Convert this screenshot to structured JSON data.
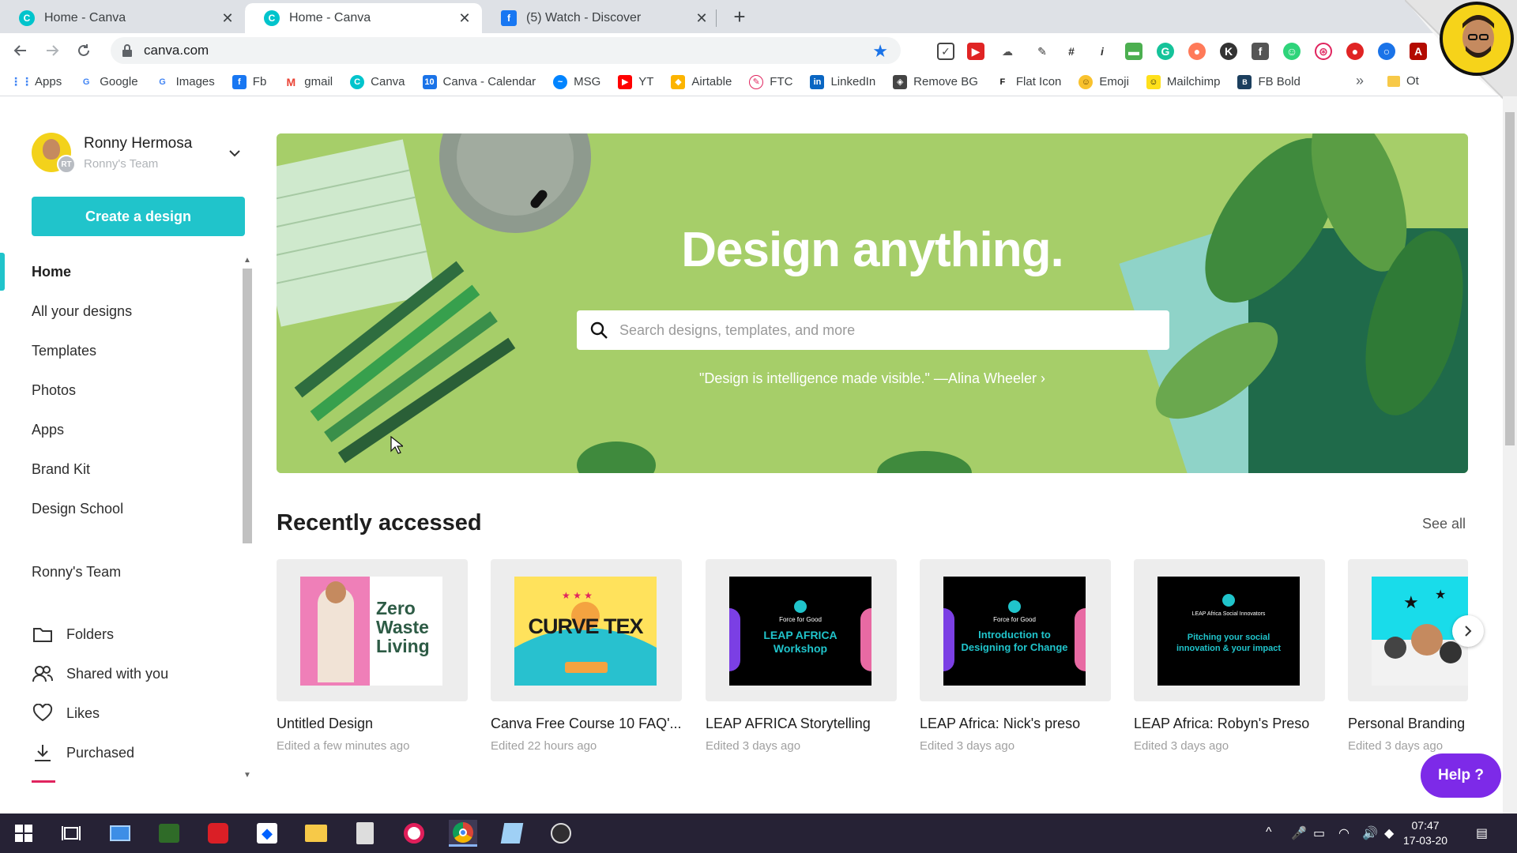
{
  "browser": {
    "tabs": [
      {
        "title": "Home - Canva",
        "icon": "canva-icon",
        "color": "#00c4cc",
        "close": "✕"
      },
      {
        "title": "Home - Canva",
        "icon": "canva-icon",
        "color": "#00c4cc",
        "close": "✕",
        "active": true
      },
      {
        "title": "(5) Watch - Discover",
        "icon": "facebook-icon",
        "color": "#1877f2",
        "close": "✕"
      }
    ],
    "new_tab": "+",
    "url": "canva.com",
    "bookmarks": [
      {
        "label": "Apps",
        "icon": "apps-grid-icon"
      },
      {
        "label": "Google",
        "icon": "google-icon"
      },
      {
        "label": "Images",
        "icon": "google-icon"
      },
      {
        "label": "Fb",
        "icon": "facebook-icon"
      },
      {
        "label": "gmail",
        "icon": "gmail-icon"
      },
      {
        "label": "Canva",
        "icon": "canva-icon"
      },
      {
        "label": "Canva - Calendar",
        "icon": "calendar-icon"
      },
      {
        "label": "MSG",
        "icon": "messenger-icon"
      },
      {
        "label": "YT",
        "icon": "youtube-icon"
      },
      {
        "label": "Airtable",
        "icon": "airtable-icon"
      },
      {
        "label": "FTC",
        "icon": "ftc-icon"
      },
      {
        "label": "LinkedIn",
        "icon": "linkedin-icon"
      },
      {
        "label": "Remove BG",
        "icon": "removebg-icon"
      },
      {
        "label": "Flat Icon",
        "icon": "flaticon-icon"
      },
      {
        "label": "Emoji",
        "icon": "emoji-icon"
      },
      {
        "label": "Mailchimp",
        "icon": "mailchimp-icon"
      },
      {
        "label": "FB Bold",
        "icon": "fbbold-icon"
      }
    ],
    "bookmarks_more": "»",
    "bookmarks_other": "Ot"
  },
  "sidebar": {
    "user_name": "Ronny Hermosa",
    "team_name": "Ronny's Team",
    "avatar_badge": "RT",
    "create_label": "Create a design",
    "nav": [
      {
        "label": "Home",
        "active": true
      },
      {
        "label": "All your designs"
      },
      {
        "label": "Templates"
      },
      {
        "label": "Photos"
      },
      {
        "label": "Apps"
      },
      {
        "label": "Brand Kit"
      },
      {
        "label": "Design School"
      }
    ],
    "team_heading": "Ronny's Team",
    "team_nav": [
      {
        "label": "Folders",
        "icon": "folder-icon"
      },
      {
        "label": "Shared with you",
        "icon": "shared-users-icon"
      },
      {
        "label": "Likes",
        "icon": "heart-icon"
      },
      {
        "label": "Purchased",
        "icon": "download-icon"
      }
    ]
  },
  "hero": {
    "title": "Design anything.",
    "search_placeholder": "Search designs, templates, and more",
    "quote": "\"Design is intelligence made visible.\" —Alina Wheeler ›"
  },
  "recent": {
    "title": "Recently accessed",
    "see_all": "See all",
    "items": [
      {
        "name": "Untitled Design",
        "edited": "Edited a few minutes ago",
        "thumb_text": "Zero Waste Living"
      },
      {
        "name": "Canva Free Course 10 FAQ'...",
        "edited": "Edited 22 hours ago",
        "thumb_text": "CURVE TEX"
      },
      {
        "name": "LEAP AFRICA Storytelling",
        "edited": "Edited 3 days ago",
        "thumb_top": "Force for Good",
        "thumb_text": "LEAP AFRICA Workshop"
      },
      {
        "name": "LEAP Africa: Nick's preso",
        "edited": "Edited 3 days ago",
        "thumb_top": "Force for Good",
        "thumb_text": "Introduction to Designing for Change"
      },
      {
        "name": "LEAP Africa: Robyn's Preso",
        "edited": "Edited 3 days ago",
        "thumb_top": "LEAP Africa Social Innovators",
        "thumb_text": "Pitching your social innovation & your impact"
      },
      {
        "name": "Personal Branding",
        "edited": "Edited 3 days ago"
      }
    ]
  },
  "help": {
    "label": "Help ?"
  },
  "taskbar": {
    "time": "07:47",
    "date": "17-03-20"
  },
  "colors": {
    "canva_teal": "#20c4cb",
    "hero_green": "#a8cf6a",
    "help_purple": "#7d2ae8",
    "taskbar": "#262235"
  }
}
